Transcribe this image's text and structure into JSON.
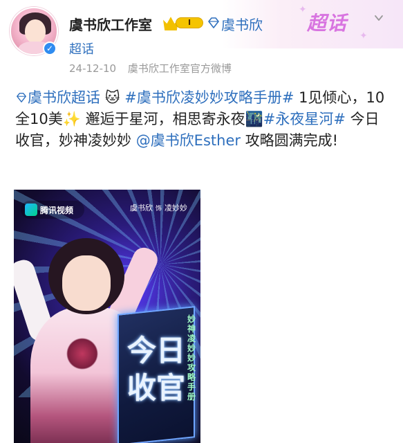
{
  "profile": {
    "name": "虞书欣工作室",
    "vip_level": "I",
    "topic_link": "虞书欣",
    "supertopic_label": "超话",
    "date": "24-12-10",
    "source": "虞书欣工作室官方微博",
    "verified": true
  },
  "header": {
    "supertopic_logo": "超话"
  },
  "post": {
    "topic_tag": "虞书欣超话",
    "hashtag1": "#虞书欣凌妙妙攻略手册#",
    "text1a": "1见倾心，10全10美",
    "text1b": "邂逅于星河，相思寄永夜",
    "hashtag2": "#永夜星河#",
    "text2": "今日收官，妙神凌妙妙",
    "mention": "@虞书欣Esther",
    "text3": "攻略圆满完成!"
  },
  "poster": {
    "platform_logo_text": "腾讯视频",
    "credit_actor": "虞书欣",
    "credit_sep": "饰",
    "credit_role": "凌妙妙",
    "sign_text": "今日收官",
    "side_text": "妙神凌妙妙攻略手册"
  },
  "icons": {
    "topic": "diamond-topic-icon",
    "chevron": "chevron-down-icon",
    "cat": "cat-emoji",
    "sparkles": "sparkles-emoji",
    "city": "night-city-emoji",
    "verified": "verified-check-icon"
  },
  "colors": {
    "link": "#2e6fbd",
    "meta": "#999999",
    "supertopic": "#d874e0",
    "vip": "#f5c400"
  }
}
